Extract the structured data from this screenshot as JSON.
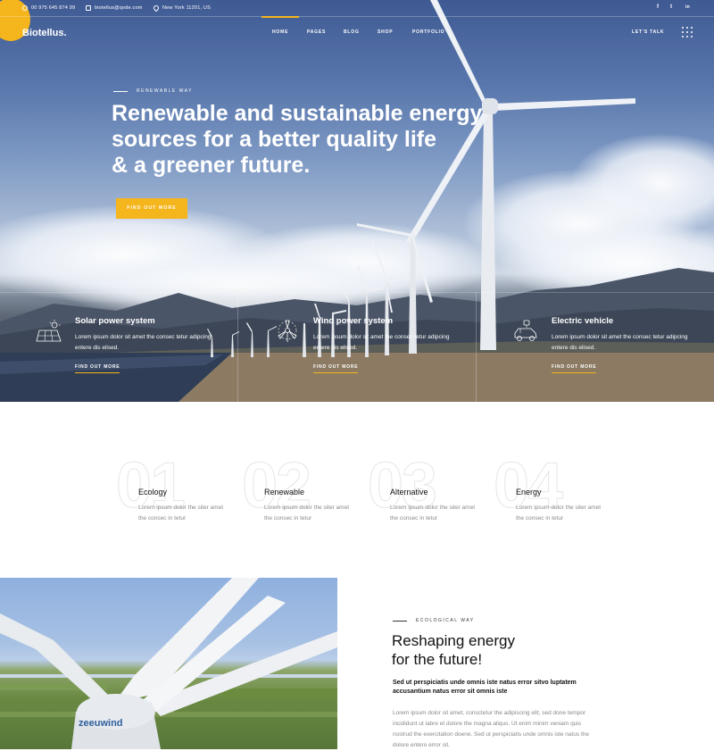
{
  "topbar": {
    "phone": "00 975 645 874 99",
    "email": "biotellus@qode.com",
    "address": "New York 11201, US",
    "social": [
      "f",
      "t",
      "in"
    ]
  },
  "header": {
    "logo": "Biotellus.",
    "nav": [
      "HOME",
      "PAGES",
      "BLOG",
      "SHOP",
      "PORTFOLIO"
    ],
    "active_nav": "HOME",
    "cta": "LET'S TALK"
  },
  "hero": {
    "eyebrow": "RENEWABLE WAY",
    "headline_lines": [
      "Renewable and sustainable energy",
      "sources for a better quality life",
      "& a greener future."
    ],
    "button": "FIND OUT MORE"
  },
  "features": [
    {
      "icon": "solar-panel-icon",
      "title": "Solar power system",
      "text": "Lorem ipsum dolor sit amet the consec tetur adipcing entere dis elised.",
      "link": "FIND OUT MORE"
    },
    {
      "icon": "wind-turbine-icon",
      "title": "Wind power system",
      "text": "Lorem ipsum dolor sit amet the consec tetur adipcing entere dis elised.",
      "link": "FIND OUT MORE"
    },
    {
      "icon": "electric-car-icon",
      "title": "Electric vehicle",
      "text": "Lorem ipsum dolor sit amet the consec tetur adipcing entere dis elised.",
      "link": "FIND OUT MORE"
    }
  ],
  "steps": [
    {
      "num": "01",
      "title": "Ecology",
      "text": "Lorem ipsum dolor the siter amet the consec in tetur"
    },
    {
      "num": "02",
      "title": "Renewable",
      "text": "Lorem ipsum dolor the siter amet the consec in tetur"
    },
    {
      "num": "03",
      "title": "Alternative",
      "text": "Lorem ipsum dolor the siter amet the consec in tetur"
    },
    {
      "num": "04",
      "title": "Energy",
      "text": "Lorem ipsum dolor the siter amet the consec in tetur"
    }
  ],
  "eco": {
    "eyebrow": "ECOLOGICAL WAY",
    "title_lines": [
      "Reshaping energy",
      "for the future!"
    ],
    "lead": "Sed ut perspiciatis unde omnis iste natus error sitvo luptatem accusantium natus error sit omnis iste",
    "body": "Lorem ipsum dolor sit amet, consctetur the adipiscing elit, sed done tempor incididunt ut labre et dolore the magna aliqus. Ut enim minim veniam quis nostrud the exercitation doene. Sed ut perspiciatis unde omnis iste natus the dolore entero error sit.",
    "image_brand": "zeeuwind"
  },
  "colors": {
    "accent": "#f5b51c"
  }
}
